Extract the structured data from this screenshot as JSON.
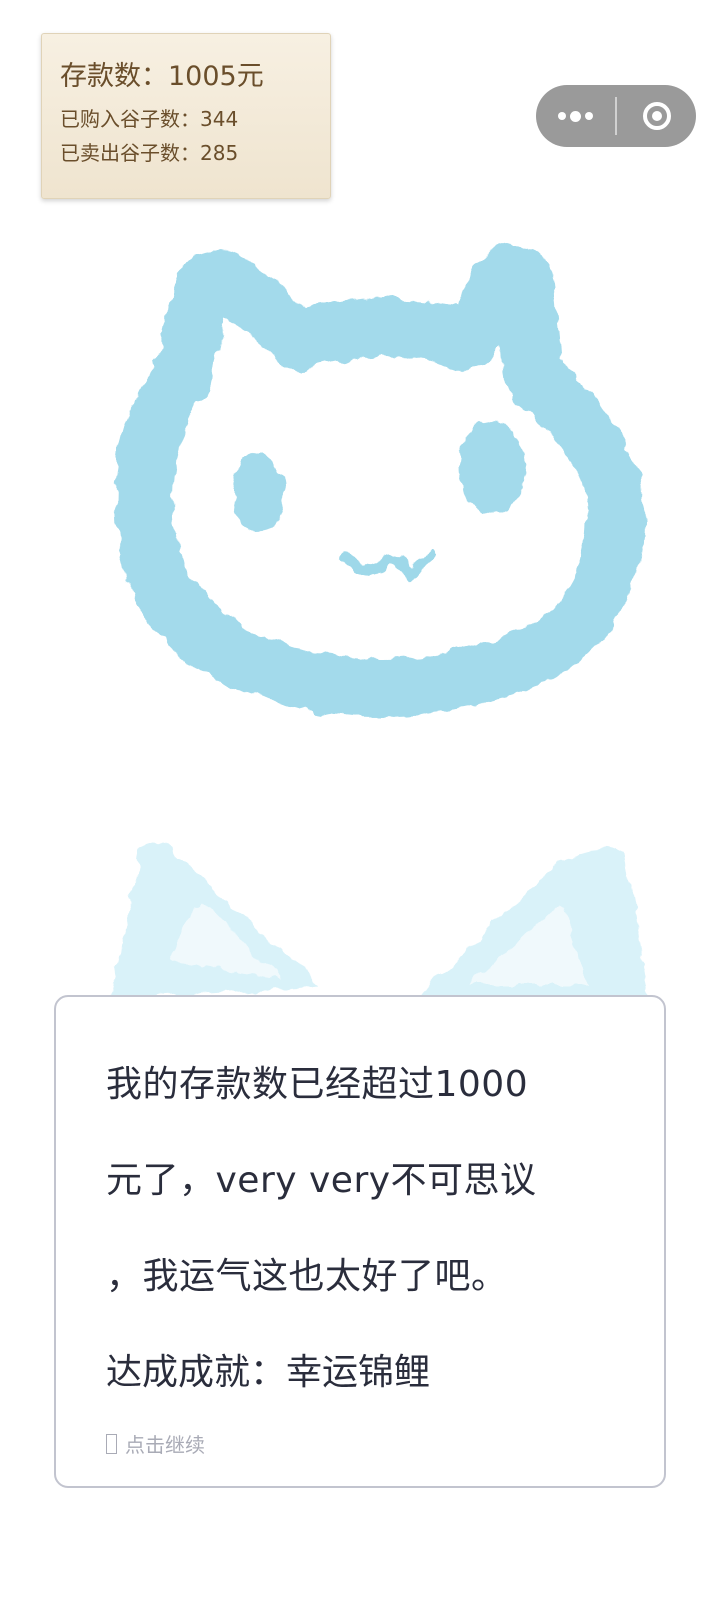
{
  "stats": {
    "deposit": "存款数：1005元",
    "bought": "已购入谷子数：344",
    "sold": "已卖出谷子数：285"
  },
  "capsule": {
    "menu_icon": "more-dots-icon",
    "close_icon": "target-close-icon"
  },
  "dialog": {
    "lines": [
      "我的存款数已经超过1000",
      "元了，very very不可思议",
      "，我运气这也太好了吧。"
    ],
    "achievement": "达成成就：幸运锦鲤",
    "continue_label": "点击继续"
  },
  "colors": {
    "cat_blue": "#8fd3e6",
    "cat_blue_light": "#cdeef8",
    "text_dark": "#2a2d3c",
    "paper": "#f3ead8",
    "paper_text": "#6a4e2b"
  }
}
